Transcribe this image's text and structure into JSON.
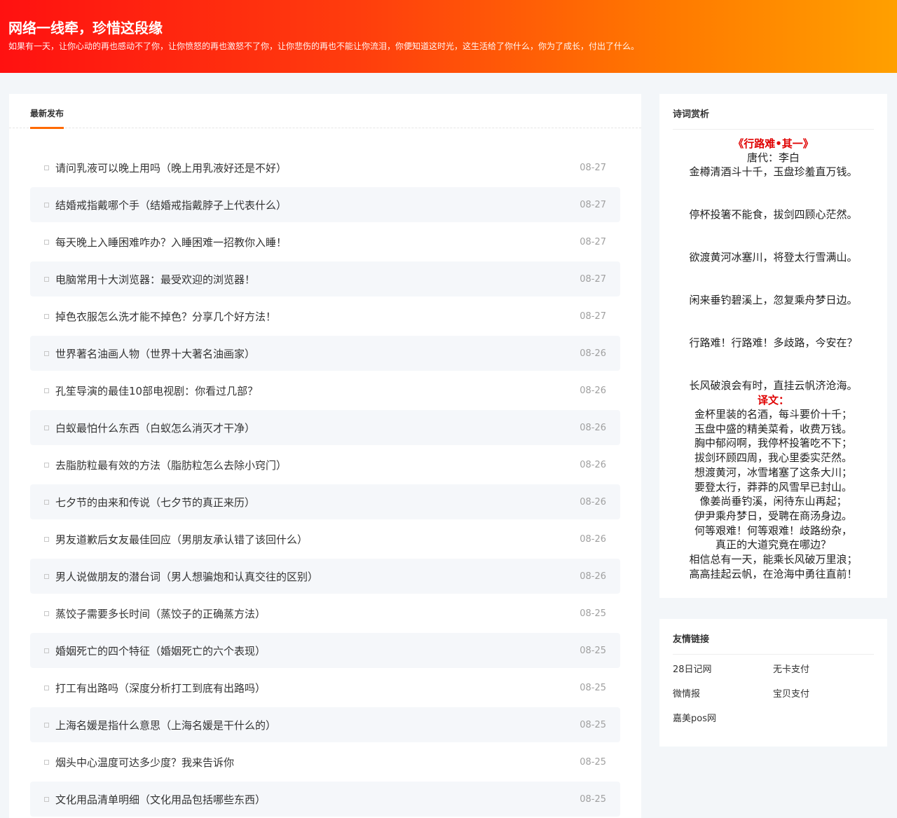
{
  "header": {
    "title": "网络一线牵，珍惜这段缘",
    "subtitle": "如果有一天，让你心动的再也感动不了你，让你愤怒的再也激怒不了你，让你悲伤的再也不能让你流泪，你便知道这时光，这生活给了你什么，你为了成长，付出了什么。"
  },
  "main": {
    "section_label": "最新发布",
    "articles": [
      {
        "title": "请问乳液可以晚上用吗（晚上用乳液好还是不好）",
        "date": "08-27"
      },
      {
        "title": "结婚戒指戴哪个手（结婚戒指戴脖子上代表什么）",
        "date": "08-27"
      },
      {
        "title": "每天晚上入睡困难咋办？入睡困难一招教你入睡！",
        "date": "08-27"
      },
      {
        "title": "电脑常用十大浏览器：最受欢迎的浏览器！",
        "date": "08-27"
      },
      {
        "title": "掉色衣服怎么洗才能不掉色？分享几个好方法！",
        "date": "08-27"
      },
      {
        "title": "世界著名油画人物（世界十大著名油画家）",
        "date": "08-26"
      },
      {
        "title": "孔笙导演的最佳10部电视剧：你看过几部？",
        "date": "08-26"
      },
      {
        "title": "白蚁最怕什么东西（白蚁怎么消灭才干净）",
        "date": "08-26"
      },
      {
        "title": "去脂肪粒最有效的方法（脂肪粒怎么去除小窍门）",
        "date": "08-26"
      },
      {
        "title": "七夕节的由来和传说（七夕节的真正来历）",
        "date": "08-26"
      },
      {
        "title": "男友道歉后女友最佳回应（男朋友承认错了该回什么）",
        "date": "08-26"
      },
      {
        "title": "男人说做朋友的潜台词（男人想骗炮和认真交往的区别）",
        "date": "08-26"
      },
      {
        "title": "蒸饺子需要多长时间（蒸饺子的正确蒸方法）",
        "date": "08-25"
      },
      {
        "title": "婚姻死亡的四个特征（婚姻死亡的六个表现）",
        "date": "08-25"
      },
      {
        "title": "打工有出路吗（深度分析打工到底有出路吗）",
        "date": "08-25"
      },
      {
        "title": "上海名媛是指什么意思（上海名媛是干什么的）",
        "date": "08-25"
      },
      {
        "title": "烟头中心温度可达多少度？我来告诉你",
        "date": "08-25"
      },
      {
        "title": "文化用品清单明细（文化用品包括哪些东西）",
        "date": "08-25"
      }
    ]
  },
  "poem_widget": {
    "heading": "诗词赏析",
    "title": "《行路难•其一》",
    "author": "唐代：李白",
    "verses": [
      "金樽清酒斗十千，玉盘珍羞直万钱。",
      "停杯投箸不能食，拔剑四顾心茫然。",
      "欲渡黄河冰塞川，将登太行雪满山。",
      "闲来垂钓碧溪上，忽复乘舟梦日边。",
      "行路难！行路难！多歧路，今安在？",
      "长风破浪会有时，直挂云帆济沧海。"
    ],
    "translation_heading": "译文：",
    "translation": [
      "金杯里装的名酒，每斗要价十千；",
      "玉盘中盛的精美菜肴，收费万钱。",
      "胸中郁闷啊，我停杯投箸吃不下；",
      "拔剑环顾四周，我心里委实茫然。",
      "想渡黄河，冰雪堵塞了这条大川；",
      "要登太行，莽莽的风雪早已封山。",
      "像姜尚垂钓溪，闲待东山再起；",
      "伊尹乘舟梦日，受聘在商汤身边。",
      "何等艰难！何等艰难！歧路纷杂，",
      "真正的大道究竟在哪边？",
      "相信总有一天，能乘长风破万里浪；",
      "高高挂起云帆，在沧海中勇往直前！"
    ]
  },
  "links_widget": {
    "heading": "友情链接",
    "links": [
      "28日记网",
      "无卡支付",
      "微情报",
      "宝贝支付",
      "嘉美pos网"
    ]
  }
}
